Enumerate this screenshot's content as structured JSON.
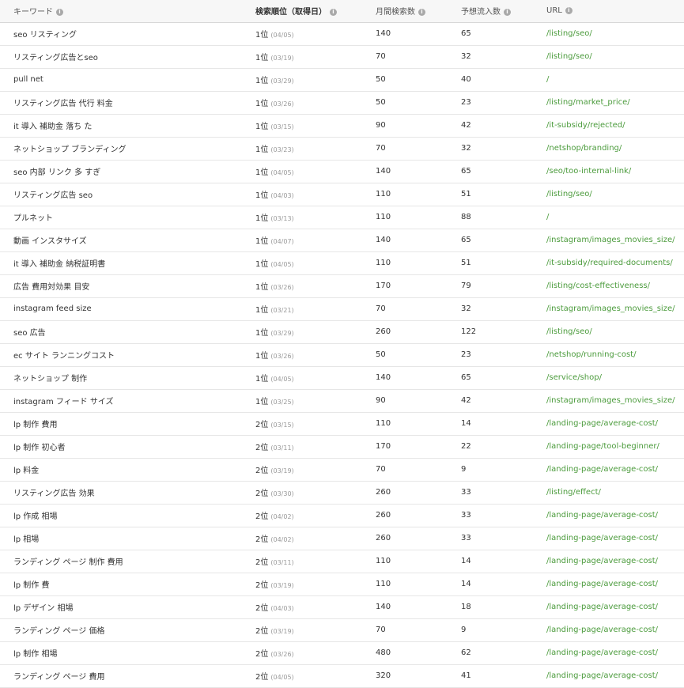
{
  "header": {
    "keyword": "キーワード",
    "rank": "検索順位（取得日）",
    "monthly": "月間検索数",
    "traffic": "予想流入数",
    "url": "URL",
    "info_icon": "i"
  },
  "rows": [
    {
      "keyword": "seo リスティング",
      "rank": "1位",
      "date": "(04/05)",
      "monthly": "140",
      "traffic": "65",
      "url": "/listing/seo/"
    },
    {
      "keyword": "リスティング広告とseo",
      "rank": "1位",
      "date": "(03/19)",
      "monthly": "70",
      "traffic": "32",
      "url": "/listing/seo/"
    },
    {
      "keyword": "pull net",
      "rank": "1位",
      "date": "(03/29)",
      "monthly": "50",
      "traffic": "40",
      "url": "/"
    },
    {
      "keyword": "リスティング広告 代行 料金",
      "rank": "1位",
      "date": "(03/26)",
      "monthly": "50",
      "traffic": "23",
      "url": "/listing/market_price/"
    },
    {
      "keyword": "it 導入 補助金 落ち た",
      "rank": "1位",
      "date": "(03/15)",
      "monthly": "90",
      "traffic": "42",
      "url": "/it-subsidy/rejected/"
    },
    {
      "keyword": "ネットショップ ブランディング",
      "rank": "1位",
      "date": "(03/23)",
      "monthly": "70",
      "traffic": "32",
      "url": "/netshop/branding/"
    },
    {
      "keyword": "seo 内部 リンク 多 すぎ",
      "rank": "1位",
      "date": "(04/05)",
      "monthly": "140",
      "traffic": "65",
      "url": "/seo/too-internal-link/"
    },
    {
      "keyword": "リスティング広告 seo",
      "rank": "1位",
      "date": "(04/03)",
      "monthly": "110",
      "traffic": "51",
      "url": "/listing/seo/"
    },
    {
      "keyword": "プルネット",
      "rank": "1位",
      "date": "(03/13)",
      "monthly": "110",
      "traffic": "88",
      "url": "/"
    },
    {
      "keyword": "動画 インスタサイズ",
      "rank": "1位",
      "date": "(04/07)",
      "monthly": "140",
      "traffic": "65",
      "url": "/instagram/images_movies_size/"
    },
    {
      "keyword": "it 導入 補助金 納税証明書",
      "rank": "1位",
      "date": "(04/05)",
      "monthly": "110",
      "traffic": "51",
      "url": "/it-subsidy/required-documents/"
    },
    {
      "keyword": "広告 費用対効果 目安",
      "rank": "1位",
      "date": "(03/26)",
      "monthly": "170",
      "traffic": "79",
      "url": "/listing/cost-effectiveness/"
    },
    {
      "keyword": "instagram feed size",
      "rank": "1位",
      "date": "(03/21)",
      "monthly": "70",
      "traffic": "32",
      "url": "/instagram/images_movies_size/"
    },
    {
      "keyword": "seo 広告",
      "rank": "1位",
      "date": "(03/29)",
      "monthly": "260",
      "traffic": "122",
      "url": "/listing/seo/"
    },
    {
      "keyword": "ec サイト ランニングコスト",
      "rank": "1位",
      "date": "(03/26)",
      "monthly": "50",
      "traffic": "23",
      "url": "/netshop/running-cost/"
    },
    {
      "keyword": "ネットショップ 制作",
      "rank": "1位",
      "date": "(04/05)",
      "monthly": "140",
      "traffic": "65",
      "url": "/service/shop/"
    },
    {
      "keyword": "instagram フィード サイズ",
      "rank": "1位",
      "date": "(03/25)",
      "monthly": "90",
      "traffic": "42",
      "url": "/instagram/images_movies_size/"
    },
    {
      "keyword": "lp 制作 費用",
      "rank": "2位",
      "date": "(03/15)",
      "monthly": "110",
      "traffic": "14",
      "url": "/landing-page/average-cost/"
    },
    {
      "keyword": "lp 制作 初心者",
      "rank": "2位",
      "date": "(03/11)",
      "monthly": "170",
      "traffic": "22",
      "url": "/landing-page/tool-beginner/"
    },
    {
      "keyword": "lp 料金",
      "rank": "2位",
      "date": "(03/19)",
      "monthly": "70",
      "traffic": "9",
      "url": "/landing-page/average-cost/"
    },
    {
      "keyword": "リスティング広告 効果",
      "rank": "2位",
      "date": "(03/30)",
      "monthly": "260",
      "traffic": "33",
      "url": "/listing/effect/"
    },
    {
      "keyword": "lp 作成 相場",
      "rank": "2位",
      "date": "(04/02)",
      "monthly": "260",
      "traffic": "33",
      "url": "/landing-page/average-cost/"
    },
    {
      "keyword": "lp 相場",
      "rank": "2位",
      "date": "(04/02)",
      "monthly": "260",
      "traffic": "33",
      "url": "/landing-page/average-cost/"
    },
    {
      "keyword": "ランディング ページ 制作 費用",
      "rank": "2位",
      "date": "(03/11)",
      "monthly": "110",
      "traffic": "14",
      "url": "/landing-page/average-cost/"
    },
    {
      "keyword": "lp 制作 費",
      "rank": "2位",
      "date": "(03/19)",
      "monthly": "110",
      "traffic": "14",
      "url": "/landing-page/average-cost/"
    },
    {
      "keyword": "lp デザイン 相場",
      "rank": "2位",
      "date": "(04/03)",
      "monthly": "140",
      "traffic": "18",
      "url": "/landing-page/average-cost/"
    },
    {
      "keyword": "ランディング ページ 価格",
      "rank": "2位",
      "date": "(03/19)",
      "monthly": "70",
      "traffic": "9",
      "url": "/landing-page/average-cost/"
    },
    {
      "keyword": "lp 制作 相場",
      "rank": "2位",
      "date": "(03/26)",
      "monthly": "480",
      "traffic": "62",
      "url": "/landing-page/average-cost/"
    },
    {
      "keyword": "ランディング ページ 費用",
      "rank": "2位",
      "date": "(04/05)",
      "monthly": "320",
      "traffic": "41",
      "url": "/landing-page/average-cost/"
    }
  ]
}
